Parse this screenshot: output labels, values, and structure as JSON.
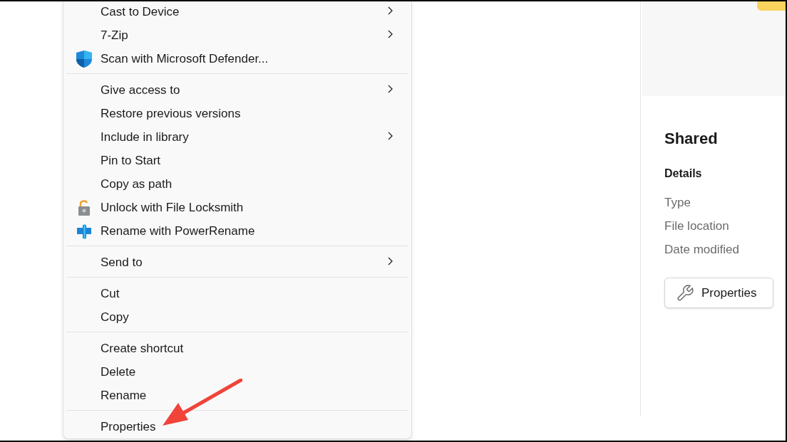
{
  "context_menu": {
    "groups": [
      {
        "items": [
          {
            "label": "Cast to Device",
            "submenu": true
          },
          {
            "label": "7-Zip",
            "submenu": true
          },
          {
            "label": "Scan with Microsoft Defender...",
            "submenu": false
          }
        ]
      },
      {
        "items": [
          {
            "label": "Give access to",
            "submenu": true
          },
          {
            "label": "Restore previous versions",
            "submenu": false
          },
          {
            "label": "Include in library",
            "submenu": true
          },
          {
            "label": "Pin to Start",
            "submenu": false
          },
          {
            "label": "Copy as path",
            "submenu": false
          },
          {
            "label": "Unlock with File Locksmith",
            "submenu": false
          },
          {
            "label": "Rename with PowerRename",
            "submenu": false
          }
        ]
      },
      {
        "items": [
          {
            "label": "Send to",
            "submenu": true
          }
        ]
      },
      {
        "items": [
          {
            "label": "Cut",
            "submenu": false
          },
          {
            "label": "Copy",
            "submenu": false
          }
        ]
      },
      {
        "items": [
          {
            "label": "Create shortcut",
            "submenu": false
          },
          {
            "label": "Delete",
            "submenu": false
          },
          {
            "label": "Rename",
            "submenu": false
          }
        ]
      },
      {
        "items": [
          {
            "label": "Properties",
            "submenu": false
          }
        ]
      }
    ]
  },
  "details_pane": {
    "title": "Shared",
    "section": "Details",
    "fields": [
      "Type",
      "File location",
      "Date modified"
    ],
    "button": "Properties"
  }
}
